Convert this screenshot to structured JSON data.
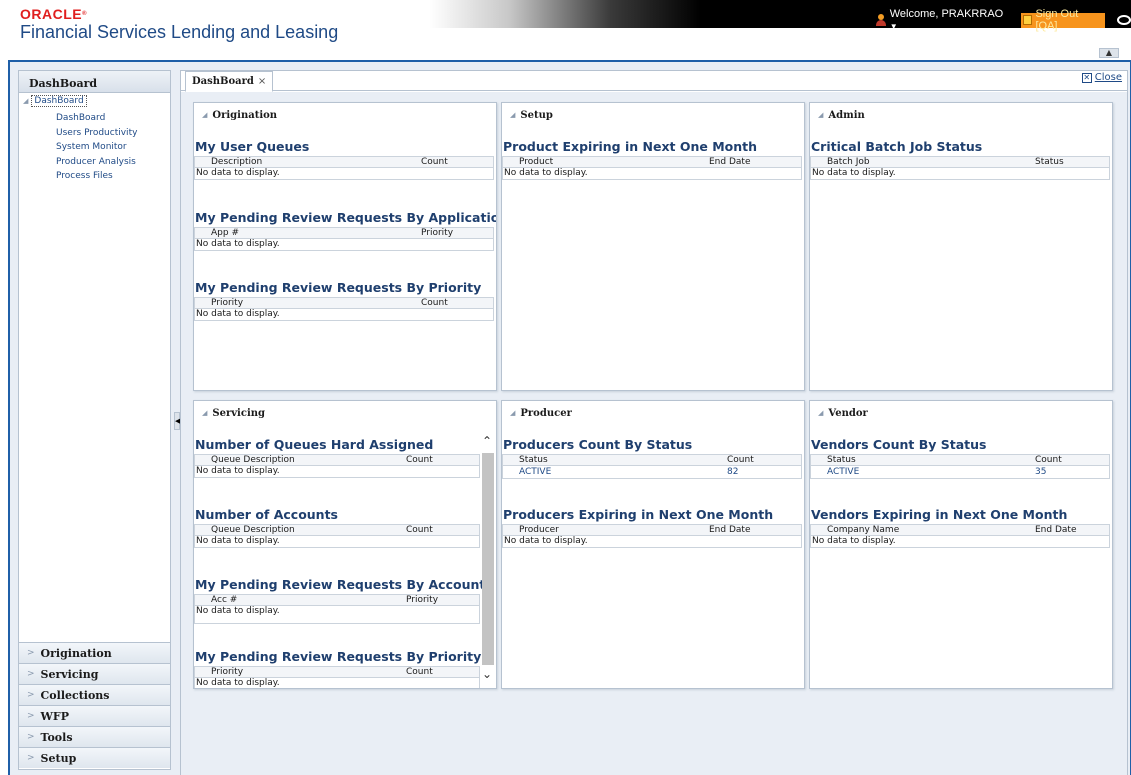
{
  "header": {
    "logo": "ORACLE",
    "logo_mark": "®",
    "subtitle": "Financial Services Lending and Leasing",
    "welcome": "Welcome, PRAKRRAO",
    "signout": "Sign Out [QA]"
  },
  "sidebar": {
    "title": "DashBoard",
    "tree_root": "DashBoard",
    "tree_items": [
      "DashBoard",
      "Users Productivity",
      "System Monitor",
      "Producer Analysis",
      "Process Files"
    ],
    "accordion": [
      "Origination",
      "Servicing",
      "Collections",
      "WFP",
      "Tools",
      "Setup"
    ]
  },
  "tabs": {
    "active": "DashBoard",
    "close_label": "Close"
  },
  "empty_text": "No data to display.",
  "panels": {
    "origination": {
      "title": "Origination",
      "sections": [
        {
          "title": "My User Queues",
          "cols": [
            "Description",
            "Count"
          ]
        },
        {
          "title": "My Pending Review Requests By Applications",
          "cols": [
            "App #",
            "Priority"
          ]
        },
        {
          "title": "My Pending Review Requests By Priority",
          "cols": [
            "Priority",
            "Count"
          ]
        }
      ]
    },
    "setup": {
      "title": "Setup",
      "sections": [
        {
          "title": "Product Expiring in Next One Month",
          "cols": [
            "Product",
            "End Date"
          ]
        }
      ]
    },
    "admin": {
      "title": "Admin",
      "sections": [
        {
          "title": "Critical Batch Job Status",
          "cols": [
            "Batch Job",
            "Status"
          ]
        }
      ]
    },
    "servicing": {
      "title": "Servicing",
      "sections": [
        {
          "title": "Number of Queues Hard Assigned",
          "cols": [
            "Queue Description",
            "Count"
          ]
        },
        {
          "title": "Number of Accounts",
          "cols": [
            "Queue Description",
            "Count"
          ]
        },
        {
          "title": "My Pending Review Requests By Accounts",
          "cols": [
            "Acc #",
            "Priority"
          ]
        },
        {
          "title": "My Pending Review Requests By Priority",
          "cols": [
            "Priority",
            "Count"
          ]
        }
      ]
    },
    "producer": {
      "title": "Producer",
      "sections": [
        {
          "title": "Producers Count By Status",
          "cols": [
            "Status",
            "Count"
          ],
          "row": [
            "ACTIVE",
            "82"
          ]
        },
        {
          "title": "Producers Expiring in Next One Month",
          "cols": [
            "Producer",
            "End Date"
          ]
        }
      ]
    },
    "vendor": {
      "title": "Vendor",
      "sections": [
        {
          "title": "Vendors Count By Status",
          "cols": [
            "Status",
            "Count"
          ],
          "row": [
            "ACTIVE",
            "35"
          ]
        },
        {
          "title": "Vendors Expiring in Next One Month",
          "cols": [
            "Company Name",
            "End Date"
          ]
        }
      ]
    }
  },
  "icons": {
    "user": "user-icon",
    "signout": "signout-icon",
    "ring": "ring-icon",
    "tree_expand": "triangle-expanded-icon",
    "accordion": "chevron-right-icon",
    "close": "close-icon",
    "scroll_up": "chevron-up-icon",
    "scroll_down": "chevron-down-icon"
  },
  "colors": {
    "brand_red": "#e01e1e",
    "title_blue": "#1f4a86",
    "signout_orange": "#f7941d",
    "frame_blue": "#1f5fa8"
  }
}
